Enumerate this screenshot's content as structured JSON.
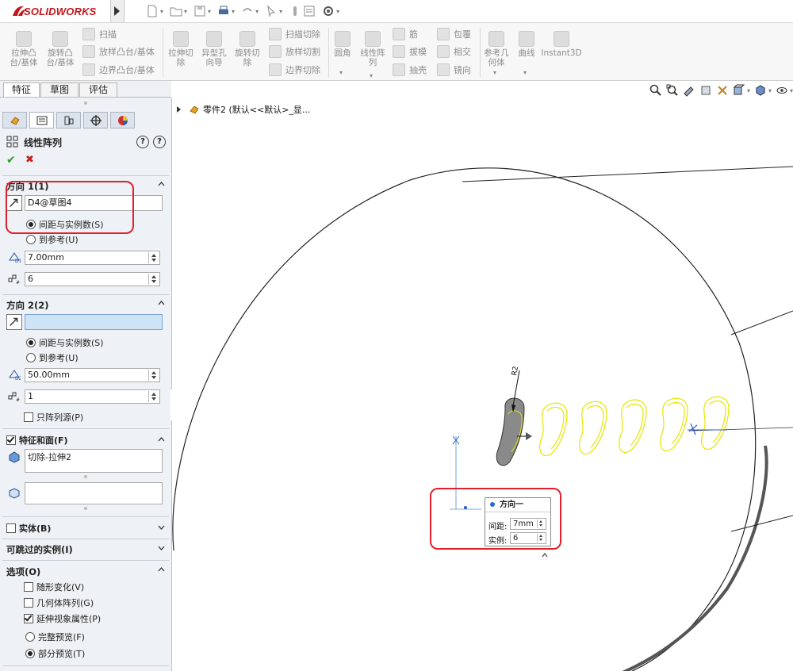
{
  "app": {
    "logo_text": "SOLIDWORKS"
  },
  "ribbon": {
    "group1": [
      {
        "label": "拉伸凸\n台/基体"
      },
      {
        "label": "旋转凸\n台/基体"
      }
    ],
    "group1_small": [
      "扫描",
      "放样凸台/基体",
      "边界凸台/基体"
    ],
    "group2": [
      {
        "label": "拉伸切\n除"
      },
      {
        "label": "异型孔\n向导"
      },
      {
        "label": "旋转切\n除"
      }
    ],
    "group2_small": [
      "扫描切除",
      "放样切割",
      "边界切除"
    ],
    "group3": [
      {
        "label": "圆角"
      },
      {
        "label": "线性阵\n列"
      }
    ],
    "group3_small_a": [
      "筋",
      "拔模",
      "抽壳"
    ],
    "group3_small_b": [
      "包覆",
      "相交",
      "镜向"
    ],
    "group4": [
      {
        "label": "参考几\n何体"
      },
      {
        "label": "曲线"
      },
      {
        "label": "Instant3D"
      }
    ]
  },
  "tabs": [
    "特征",
    "草图",
    "评估"
  ],
  "property_manager": {
    "title": "线性阵列",
    "help1": "?",
    "help2": "?",
    "ok": "✔",
    "cancel": "✖",
    "dir1": {
      "label": "方向 1(1)",
      "selection": "D4@草图4",
      "opt_spacing": "间距与实例数(S)",
      "opt_ref": "到参考(U)",
      "spacing": "7.00mm",
      "instances": "6"
    },
    "dir2": {
      "label": "方向 2(2)",
      "selection": "",
      "opt_spacing": "间距与实例数(S)",
      "opt_ref": "到参考(U)",
      "spacing": "50.00mm",
      "instances": "1",
      "seed_only": "只阵列源(P)"
    },
    "features": {
      "label": "特征和面(F)",
      "item": "切除-拉伸2"
    },
    "bodies": {
      "label": "实体(B)"
    },
    "skip": {
      "label": "可跳过的实例(I)"
    },
    "options": {
      "label": "选项(O)",
      "vary": "随形变化(V)",
      "geom": "几何体阵列(G)",
      "propagate": "延伸视象属性(P)",
      "full": "完整预览(F)",
      "partial": "部分预览(T)"
    }
  },
  "viewport": {
    "tree_label": "零件2  (默认<<默认>_显...",
    "dim_label": "R2",
    "popup": {
      "title": "方向一",
      "spacing_label": "间距:",
      "spacing_value": "7mm",
      "instances_label": "实例:",
      "instances_value": "6"
    }
  },
  "colors": {
    "accent_red": "#e0202a",
    "preview_yellow": "#e6e600",
    "logo_red": "#c4161c"
  }
}
